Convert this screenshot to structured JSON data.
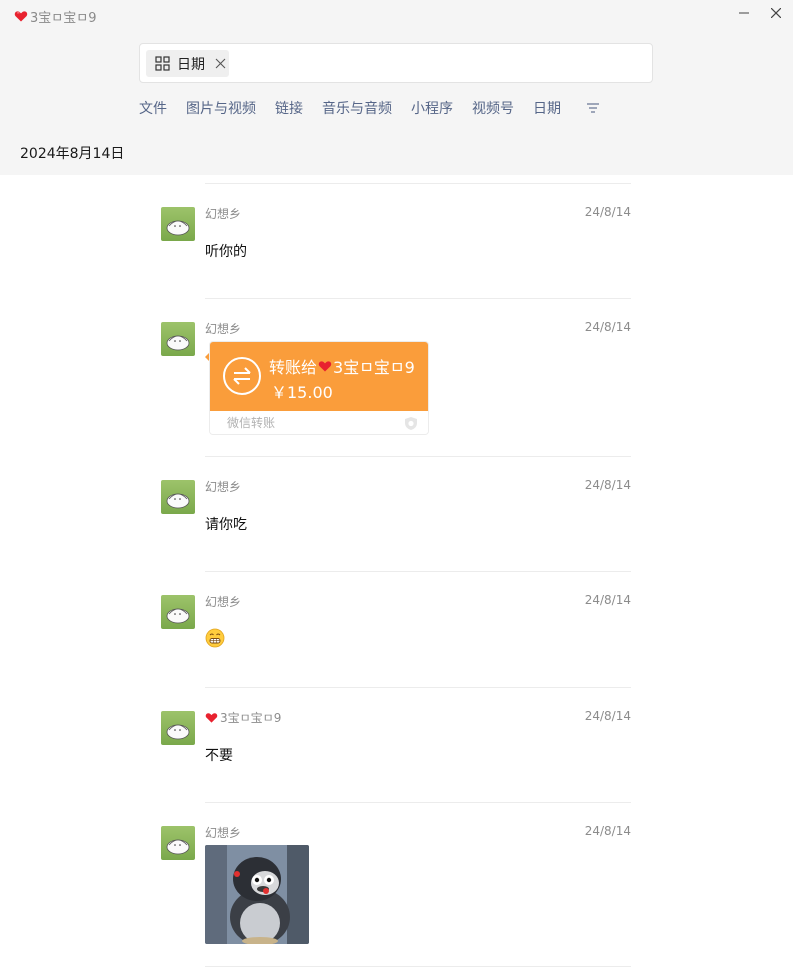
{
  "window": {
    "title": "3宝ㅁ宝ㅁ9",
    "minimize_icon": "minimize-icon",
    "close_icon": "close-icon"
  },
  "search": {
    "chip_label": "日期",
    "chip_icon": "grid-icon",
    "chip_close_icon": "close-icon"
  },
  "filters": [
    "文件",
    "图片与视频",
    "链接",
    "音乐与音频",
    "小程序",
    "视频号",
    "日期"
  ],
  "date_heading": "2024年8月14日",
  "messages": [
    {
      "sender": "幻想乡",
      "time": "24/8/14",
      "type": "text",
      "content": "听你的"
    },
    {
      "sender": "幻想乡",
      "time": "24/8/14",
      "type": "transfer",
      "transfer": {
        "title": "转账给",
        "recipient": "3宝ㅁ宝ㅁ9",
        "amount": "￥15.00",
        "footer": "微信转账"
      }
    },
    {
      "sender": "幻想乡",
      "time": "24/8/14",
      "type": "text",
      "content": "请你吃"
    },
    {
      "sender": "幻想乡",
      "time": "24/8/14",
      "type": "emoji",
      "emoji": "grimacing-face-icon"
    },
    {
      "sender": "3宝ㅁ宝ㅁ9",
      "time": "24/8/14",
      "type": "text",
      "content": "不要"
    },
    {
      "sender": "幻想乡",
      "time": "24/8/14",
      "type": "image",
      "image": "penguin-sticker"
    }
  ],
  "colors": {
    "accent_orange": "#fa9d3b",
    "filter_text": "#566688",
    "header_bg": "#f5f5f5"
  }
}
